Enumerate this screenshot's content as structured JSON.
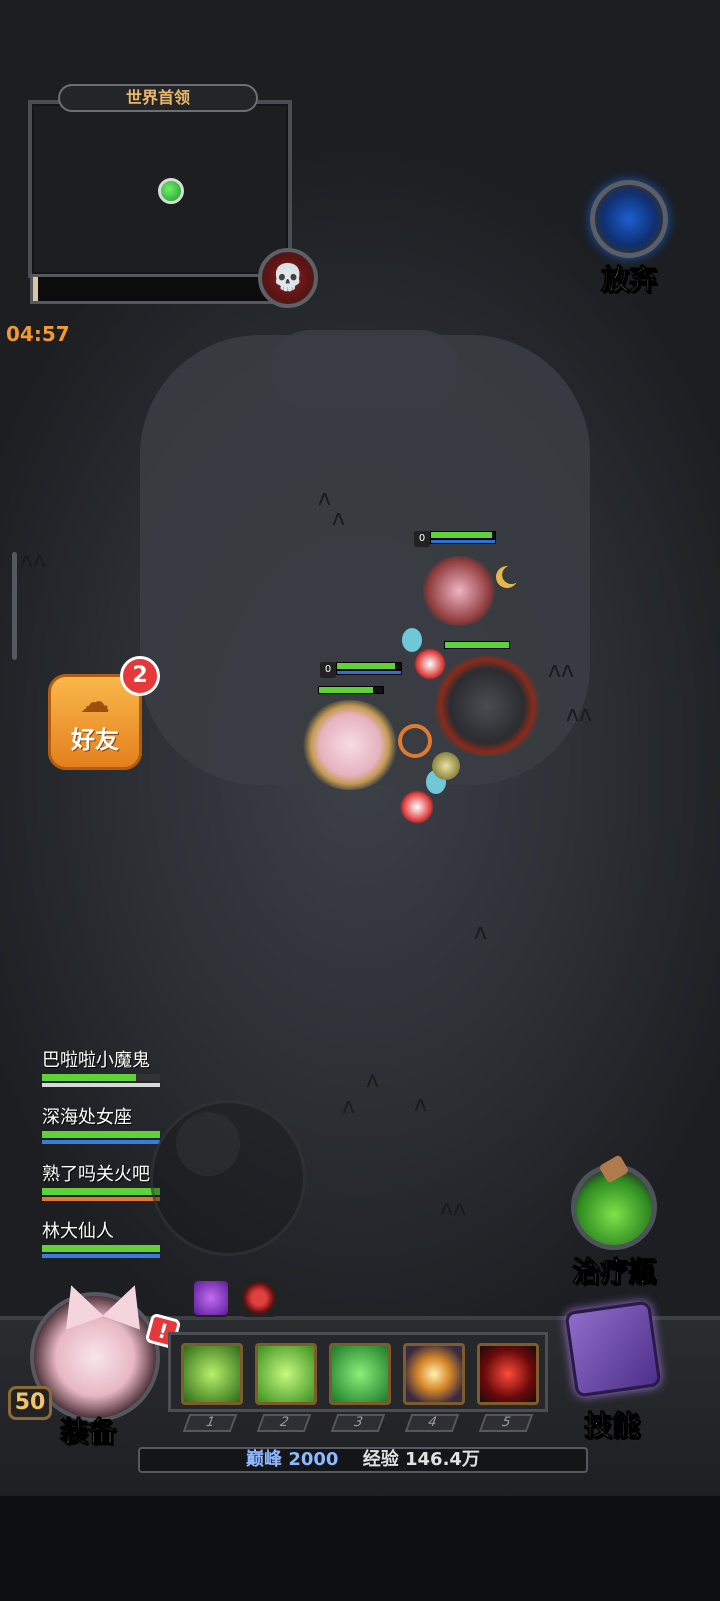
{
  "minimap": {
    "title": "世界首领",
    "boss_hp_fraction": 0.02
  },
  "timer": "04:57",
  "giveup": {
    "label": "放弃"
  },
  "friends": {
    "label": "好友",
    "badge": "2"
  },
  "heroes": {
    "player": {
      "level": "0",
      "hp": 0.9,
      "mp": 1.0
    },
    "ally": {
      "level": "0",
      "hp": 0.95,
      "mp": 1.0
    },
    "boss": {
      "hp": 1.0
    }
  },
  "team": [
    {
      "name": "巴啦啦小魔鬼",
      "hp": 0.8,
      "sub_color": "#d9d9d9"
    },
    {
      "name": "深海处女座",
      "hp": 1.0,
      "sub_color": "#3a7be0"
    },
    {
      "name": "熟了吗关火吧",
      "hp": 1.0,
      "sub_color": "#e07a30"
    },
    {
      "name": "林大仙人",
      "hp": 1.0,
      "sub_color": "#3a7be0"
    }
  ],
  "heal": {
    "label": "治疗瓶"
  },
  "player_panel": {
    "level": "50",
    "equip_label": "装备",
    "alert": "!",
    "skill_label": "技能",
    "skills": [
      {
        "num": "1",
        "color": "#5fa830"
      },
      {
        "num": "2",
        "color": "#68c83a"
      },
      {
        "num": "3",
        "color": "#34b040"
      },
      {
        "num": "4",
        "color": "#d7882a"
      },
      {
        "num": "5",
        "color": "#9a1c1c"
      }
    ],
    "peak_label": "巅峰",
    "peak_value": "2000",
    "exp_label": "经验",
    "exp_value": "146.4万"
  }
}
